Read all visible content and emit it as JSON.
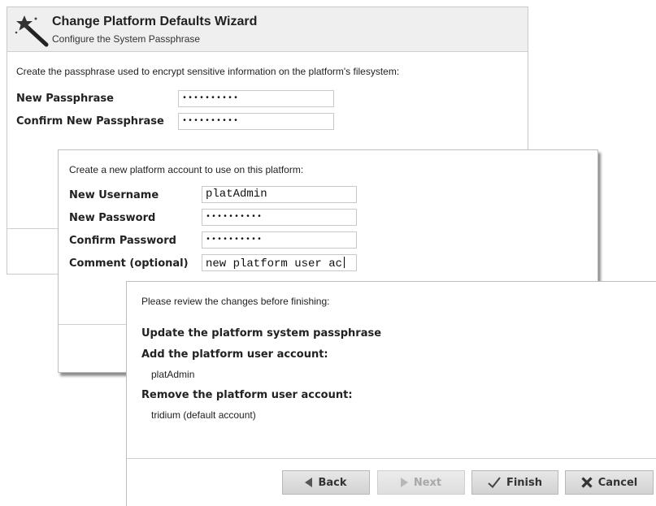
{
  "wizard": {
    "title": "Change Platform Defaults Wizard",
    "subtitle": "Configure the System Passphrase"
  },
  "passphrase_step": {
    "intro": "Create the passphrase used to encrypt sensitive information on the platform's filesystem:",
    "new_label": "New Passphrase",
    "new_value": "••••••••••",
    "confirm_label": "Confirm New Passphrase",
    "confirm_value": "••••••••••"
  },
  "account_step": {
    "intro": "Create a new platform account to use on this platform:",
    "username_label": "New Username",
    "username_value": "platAdmin",
    "password_label": "New Password",
    "password_value": "••••••••••",
    "confirm_label": "Confirm Password",
    "confirm_value": "••••••••••",
    "comment_label": "Comment (optional)",
    "comment_value": "new platform user ac"
  },
  "review_step": {
    "intro": "Please review the changes before finishing:",
    "item1": "Update the platform system passphrase",
    "item2": "Add the platform user account:",
    "item2_detail": "platAdmin",
    "item3": "Remove the platform user account:",
    "item3_detail": "tridium (default account)"
  },
  "buttons": {
    "back": "Back",
    "next": "Next",
    "finish": "Finish",
    "cancel": "Cancel"
  },
  "icons": {
    "wizard": "magic-wand-icon",
    "back": "triangle-left-icon",
    "next": "triangle-right-icon",
    "finish": "checkmark-icon",
    "cancel": "x-icon"
  },
  "colors": {
    "header_bg": "#efefef",
    "button_bg": "#d9d9d9",
    "disabled_text": "#a8a8a8"
  }
}
